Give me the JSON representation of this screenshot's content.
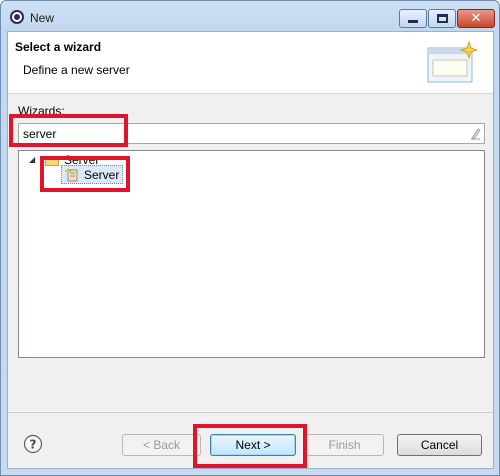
{
  "window": {
    "title": "New",
    "icon": "eclipse-icon",
    "controls": [
      "minimize-icon",
      "maximize-icon",
      "close-icon"
    ]
  },
  "header": {
    "title": "Select a wizard",
    "description": "Define a new server",
    "banner_icon": "wizard-banner-icon"
  },
  "filter": {
    "label": "Wizards:",
    "value": "server",
    "clear_icon": "clear-filter-icon"
  },
  "tree": {
    "items": [
      {
        "label": "Server",
        "expanded": true,
        "icon": "folder-icon",
        "children": [
          {
            "label": "Server",
            "selected": true,
            "icon": "server-wizard-icon"
          }
        ]
      }
    ]
  },
  "footer": {
    "help_icon": "help-icon",
    "back_label": "< Back",
    "next_label": "Next >",
    "finish_label": "Finish",
    "cancel_label": "Cancel"
  },
  "colors": {
    "annotation": "#e0152b",
    "title_bar": "#c3d7ee",
    "selection": "#dde8f7"
  }
}
